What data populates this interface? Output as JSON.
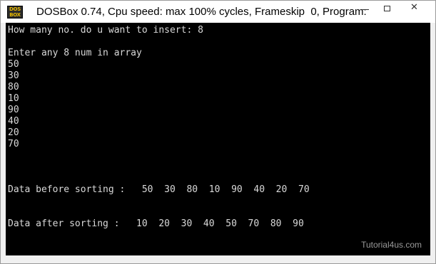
{
  "window": {
    "title": "DOSBox 0.74, Cpu speed: max 100% cycles, Frameskip  0, Program:",
    "icon_top": "DOS",
    "icon_bottom": "BOX",
    "minimize_icon": "minimize-icon",
    "maximize_icon": "maximize-icon",
    "close_icon": "close-icon",
    "close_glyph": "✕"
  },
  "console": {
    "lines": [
      "How many no. do u want to insert: 8",
      "",
      "Enter any 8 num in array",
      "50",
      "30",
      "80",
      "10",
      "90",
      "40",
      "20",
      "70",
      "",
      "",
      "",
      "Data before sorting :   50  30  80  10  90  40  20  70",
      "",
      "",
      "Data after sorting :   10  20  30  40  50  70  80  90"
    ]
  },
  "watermark": "Tutorial4us.com"
}
